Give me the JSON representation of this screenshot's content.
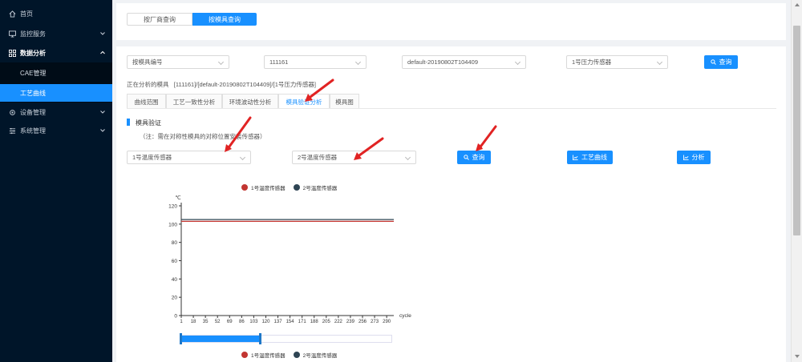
{
  "sidebar": {
    "items": [
      {
        "label": "首页",
        "icon": "home-icon"
      },
      {
        "label": "监控服务",
        "icon": "monitor-icon"
      },
      {
        "label": "数据分析",
        "icon": "grid-icon"
      },
      {
        "label": "设备管理",
        "icon": "gear-icon"
      },
      {
        "label": "系统管理",
        "icon": "settings-icon"
      }
    ],
    "sub_items": [
      {
        "label": "CAE管理"
      },
      {
        "label": "工艺曲线",
        "active": true
      }
    ]
  },
  "top": {
    "seg_vendor": "按厂商查询",
    "seg_mold": "按模具查询"
  },
  "filters": {
    "type": "按模具编号",
    "mold_no": "111161",
    "version": "default-20190802T104409",
    "sensor": "1号压力传感器",
    "query": "查询"
  },
  "analysis_label": "正在分析的模具",
  "analysis_value": "[111161]/[default-20190802T104409]/[1号压力传感器]",
  "tabs": [
    "曲线范围",
    "工艺一致性分析",
    "环境波动性分析",
    "模具验证分析",
    "模具图"
  ],
  "active_tab": 3,
  "section": {
    "title": "模具验证",
    "note": "（注：需在对称性模具的对称位置安装传感器）"
  },
  "verify": {
    "sensor1": "1号温度传感器",
    "sensor2": "2号温度传感器",
    "query": "查询",
    "curve": "工艺曲线",
    "analyze": "分析"
  },
  "colors": {
    "primary": "#1890ff",
    "sidebar": "#001529",
    "series1": "#c23531",
    "series2": "#2f4554"
  },
  "chart_data": {
    "type": "line",
    "ylabel": "℃",
    "xlabel": "cycle",
    "ylim": [
      0,
      120
    ],
    "yticks": [
      0,
      20,
      40,
      60,
      80,
      100,
      120
    ],
    "xticks": [
      "1",
      "18",
      "35",
      "52",
      "69",
      "86",
      "103",
      "120",
      "137",
      "154",
      "171",
      "188",
      "205",
      "222",
      "239",
      "256",
      "273",
      "290"
    ],
    "xlim": [
      1,
      300
    ],
    "grid": false,
    "legend_position": "top",
    "series": [
      {
        "name": "1号温度传感器",
        "color": "#c23531",
        "x": [
          1,
          100,
          200,
          300
        ],
        "values": [
          103,
          103,
          103,
          103
        ]
      },
      {
        "name": "2号温度传感器",
        "color": "#2f4554",
        "x": [
          1,
          100,
          200,
          300
        ],
        "values": [
          105,
          105,
          105,
          105
        ]
      }
    ]
  }
}
